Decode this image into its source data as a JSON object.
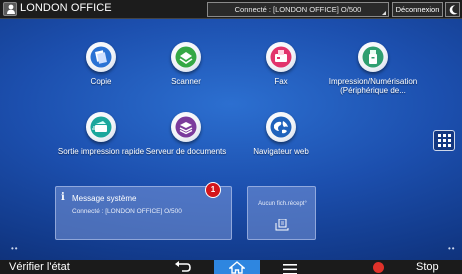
{
  "topbar": {
    "title": "LONDON OFFICE",
    "connection": "Connecté : [LONDON OFFICE] O/500",
    "logout_label": "Déconnexion"
  },
  "apps": [
    {
      "id": "copy",
      "label": "Copie",
      "icon": "copy-icon",
      "color": "#1e6fd0"
    },
    {
      "id": "scanner",
      "label": "Scanner",
      "icon": "scanner-icon",
      "color": "#2fa040"
    },
    {
      "id": "fax",
      "label": "Fax",
      "icon": "fax-icon",
      "color": "#e0336a"
    },
    {
      "id": "print-scan",
      "label": "Impression/Numérisation (Périphérique de...",
      "icon": "usb-icon",
      "color": "#2e9a6a"
    },
    {
      "id": "quick-print",
      "label": "Sortie impression rapide",
      "icon": "quick-print-icon",
      "color": "#1aa39a"
    },
    {
      "id": "document-server",
      "label": "Serveur de documents",
      "icon": "document-server-icon",
      "color": "#7a3a9a"
    },
    {
      "id": "web-browser",
      "label": "Navigateur web",
      "icon": "globe-icon",
      "color": "#1f5fb8"
    }
  ],
  "widgets": {
    "message": {
      "title": "Message système",
      "text": "Connecté : [LONDON OFFICE] O/500",
      "badge_count": "1"
    },
    "fax": {
      "text": "Aucun fich.récept°"
    }
  },
  "bottombar": {
    "check_label": "Vérifier l'état",
    "stop_label": "Stop"
  },
  "colors": {
    "accent": "#2e86e0",
    "badge": "#d4161c",
    "stop": "#e0322a"
  }
}
